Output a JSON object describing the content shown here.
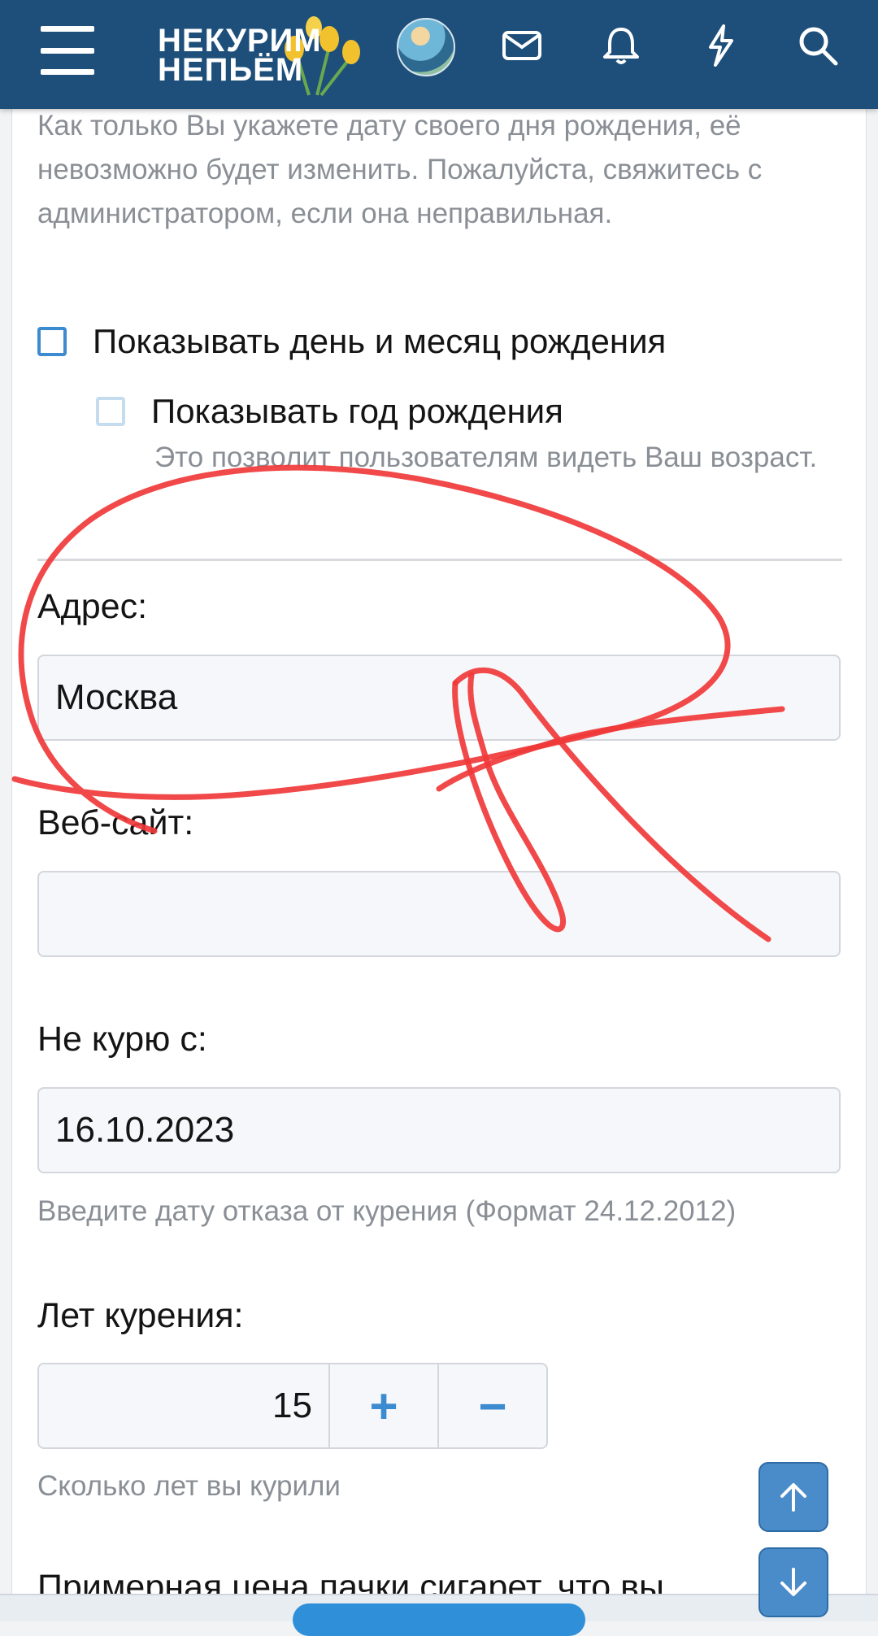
{
  "header": {
    "logo_line1": "НЕКУРИМ",
    "logo_line2": "НЕПЬЁМ",
    "icons": [
      "menu-icon",
      "mail-icon",
      "bell-icon",
      "lightning-icon",
      "search-icon"
    ]
  },
  "birthday": {
    "note": "Как только Вы укажете дату своего дня рождения, её невозможно будет изменить. Пожалуйста, свяжитесь с администратором, если она неправильная.",
    "show_day_month_label": "Показывать день и месяц рождения",
    "show_year_label": "Показывать год рождения",
    "show_year_hint": "Это позволит пользователям видеть Ваш возраст.",
    "show_day_month_checked": false,
    "show_year_checked": false
  },
  "fields": {
    "address_label": "Адрес:",
    "address_value": "Москва",
    "website_label": "Веб-сайт:",
    "website_value": "",
    "quit_label": "Не курю с:",
    "quit_value": "16.10.2023",
    "quit_hint": "Введите дату отказа от курения (Формат 24.12.2012)",
    "years_label": "Лет курения:",
    "years_value": "15",
    "years_plus": "+",
    "years_minus": "−",
    "years_hint": "Сколько лет вы курили",
    "next_label_cut": "Примерная цена пачки сигарет, что вы"
  },
  "colors": {
    "header_bg": "#1d4f7a",
    "accent": "#3c8ad0",
    "annotation": "#f03a3a"
  }
}
